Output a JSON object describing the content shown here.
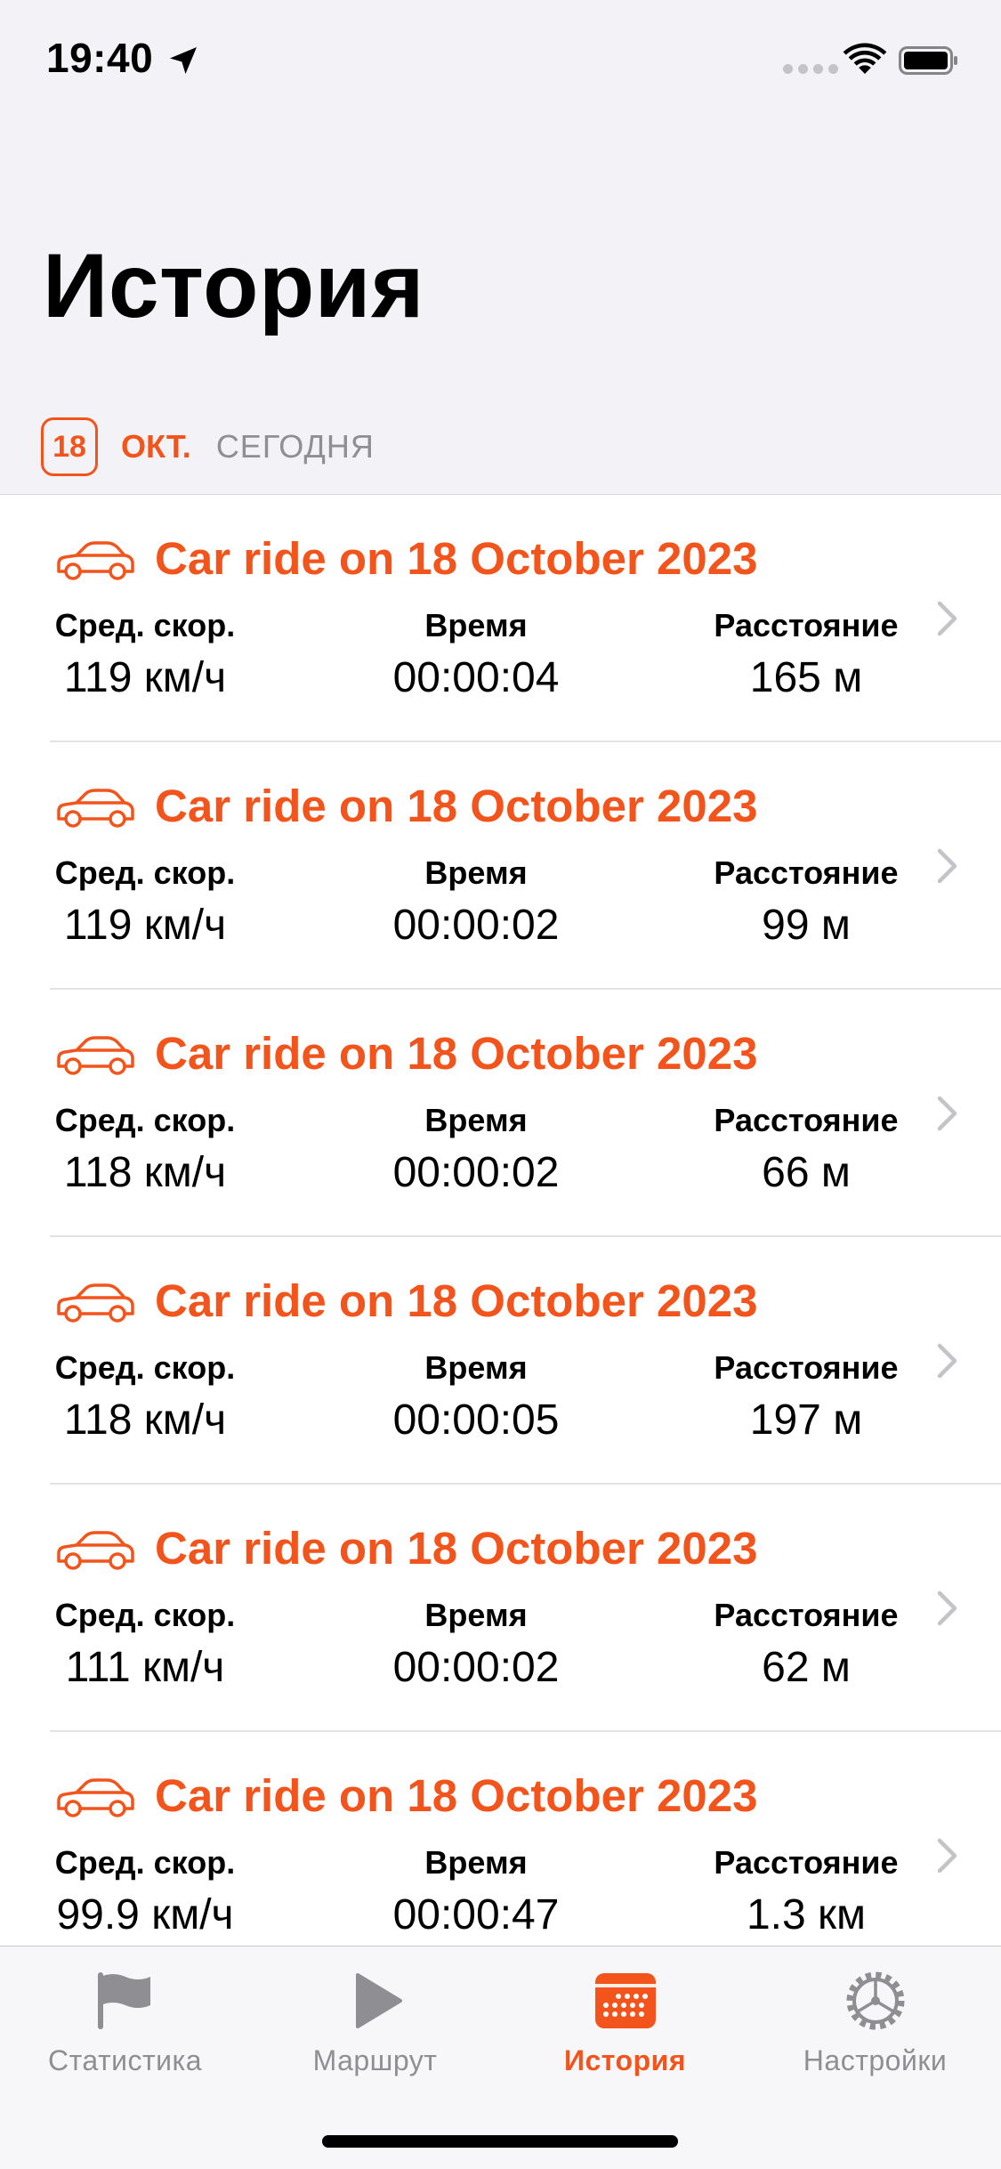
{
  "status_bar": {
    "time": "19:40"
  },
  "page": {
    "title": "История"
  },
  "date_header": {
    "day": "18",
    "month": "ОКТ.",
    "label": "СЕГОДНЯ"
  },
  "colors": {
    "accent": "#f2541b",
    "secondary_text": "#8e8e93",
    "background": "#f2f2f7"
  },
  "rides": [
    {
      "title": "Car ride on 18 October 2023",
      "speed_label": "Сред. скор.",
      "speed": "119 км/ч",
      "time_label": "Время",
      "time": "00:00:04",
      "distance_label": "Расстояние",
      "distance": "165 м"
    },
    {
      "title": "Car ride on 18 October 2023",
      "speed_label": "Сред. скор.",
      "speed": "119 км/ч",
      "time_label": "Время",
      "time": "00:00:02",
      "distance_label": "Расстояние",
      "distance": "99 м"
    },
    {
      "title": "Car ride on 18 October 2023",
      "speed_label": "Сред. скор.",
      "speed": "118 км/ч",
      "time_label": "Время",
      "time": "00:00:02",
      "distance_label": "Расстояние",
      "distance": "66 м"
    },
    {
      "title": "Car ride on 18 October 2023",
      "speed_label": "Сред. скор.",
      "speed": "118 км/ч",
      "time_label": "Время",
      "time": "00:00:05",
      "distance_label": "Расстояние",
      "distance": "197 м"
    },
    {
      "title": "Car ride on 18 October 2023",
      "speed_label": "Сред. скор.",
      "speed": "111 км/ч",
      "time_label": "Время",
      "time": "00:00:02",
      "distance_label": "Расстояние",
      "distance": "62 м"
    },
    {
      "title": "Car ride on 18 October 2023",
      "speed_label": "Сред. скор.",
      "speed": "99.9 км/ч",
      "time_label": "Время",
      "time": "00:00:47",
      "distance_label": "Расстояние",
      "distance": "1.3 км"
    }
  ],
  "tabs": [
    {
      "label": "Статистика",
      "icon": "flag-icon",
      "active": false
    },
    {
      "label": "Маршрут",
      "icon": "play-icon",
      "active": false
    },
    {
      "label": "История",
      "icon": "calendar-icon",
      "active": true
    },
    {
      "label": "Настройки",
      "icon": "gear-icon",
      "active": false
    }
  ]
}
